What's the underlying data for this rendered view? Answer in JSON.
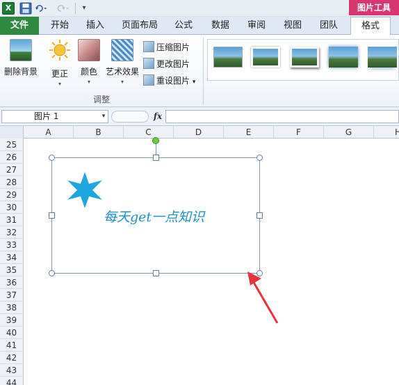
{
  "app": {
    "logo": "X",
    "tool_header": "图片工具"
  },
  "tabs": [
    {
      "label": "文件"
    },
    {
      "label": "开始"
    },
    {
      "label": "插入"
    },
    {
      "label": "页面布局"
    },
    {
      "label": "公式"
    },
    {
      "label": "数据"
    },
    {
      "label": "审阅"
    },
    {
      "label": "视图"
    },
    {
      "label": "团队"
    },
    {
      "label": "格式",
      "active": true
    }
  ],
  "ribbon": {
    "remove_background": "删除背景",
    "corrections": "更正",
    "color": "颜色",
    "artistic_effects": "艺术效果",
    "compress": "压缩图片",
    "change": "更改图片",
    "reset": "重设图片",
    "group_label": "调整",
    "dropdown_glyph": "▾"
  },
  "formula_bar": {
    "name_box": "图片 1",
    "fx": "fx",
    "formula": ""
  },
  "columns": [
    "A",
    "B",
    "C",
    "D",
    "E",
    "F",
    "G",
    "H"
  ],
  "rows": [
    "25",
    "26",
    "27",
    "28",
    "29",
    "30",
    "31",
    "32",
    "33",
    "34",
    "35",
    "36",
    "37",
    "38",
    "39",
    "40",
    "41",
    "42",
    "43",
    "44"
  ],
  "picture": {
    "text": "每天get一点知识",
    "star_color": "#1ea6e0",
    "text_color": "#1e8fcd"
  },
  "annotation": {
    "arrow_color": "#e8333a"
  }
}
